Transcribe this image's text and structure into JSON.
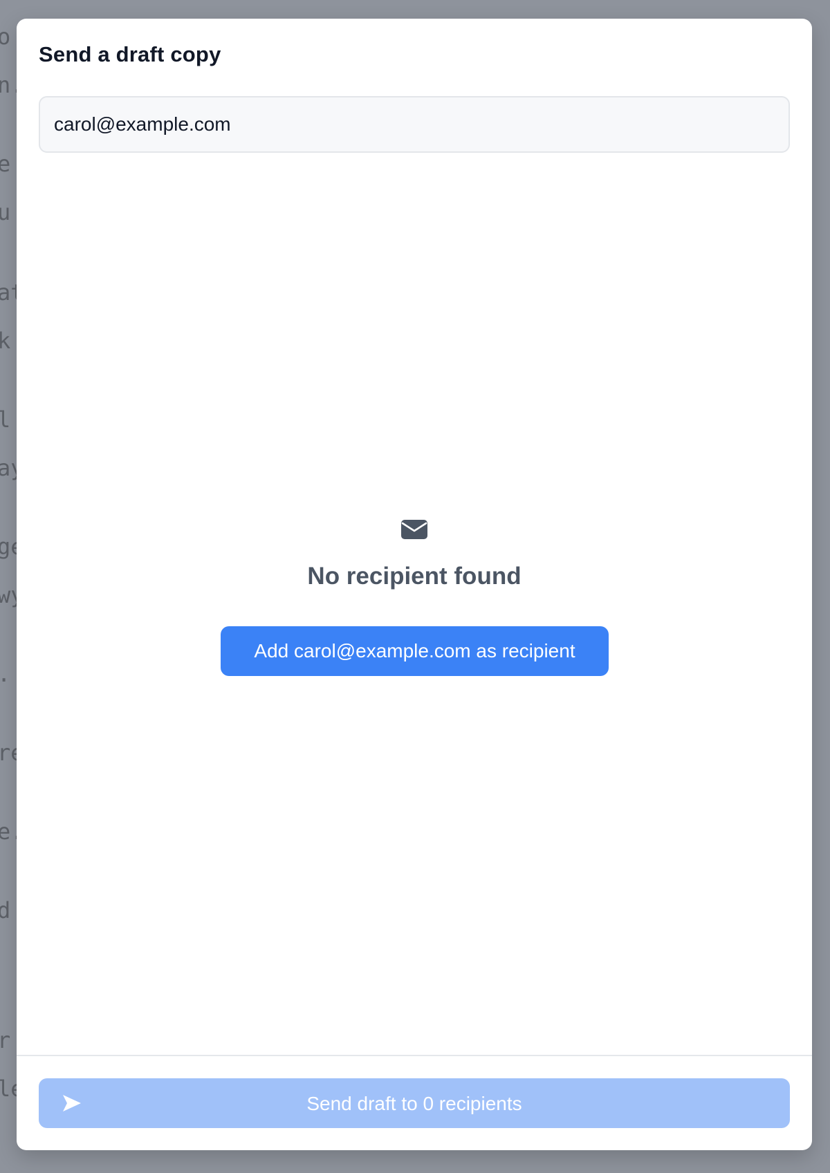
{
  "background_lines": [
    "o",
    "n.",
    "e",
    "u",
    "at",
    "k",
    "l",
    "ay",
    "ge",
    "wy",
    ".",
    "re",
    "e.",
    "d",
    "r",
    "le"
  ],
  "modal": {
    "title": "Send a draft copy",
    "search": {
      "value": "carol@example.com",
      "placeholder": ""
    },
    "empty_state": {
      "icon": "envelope-icon",
      "title": "No recipient found",
      "add_button_label": "Add carol@example.com as recipient"
    },
    "footer": {
      "send_icon": "send-icon",
      "send_label": "Send draft to 0 recipients"
    }
  },
  "colors": {
    "accent": "#3b82f6",
    "accent_disabled": "#a0c1f9",
    "overlay": "#8e939c"
  }
}
